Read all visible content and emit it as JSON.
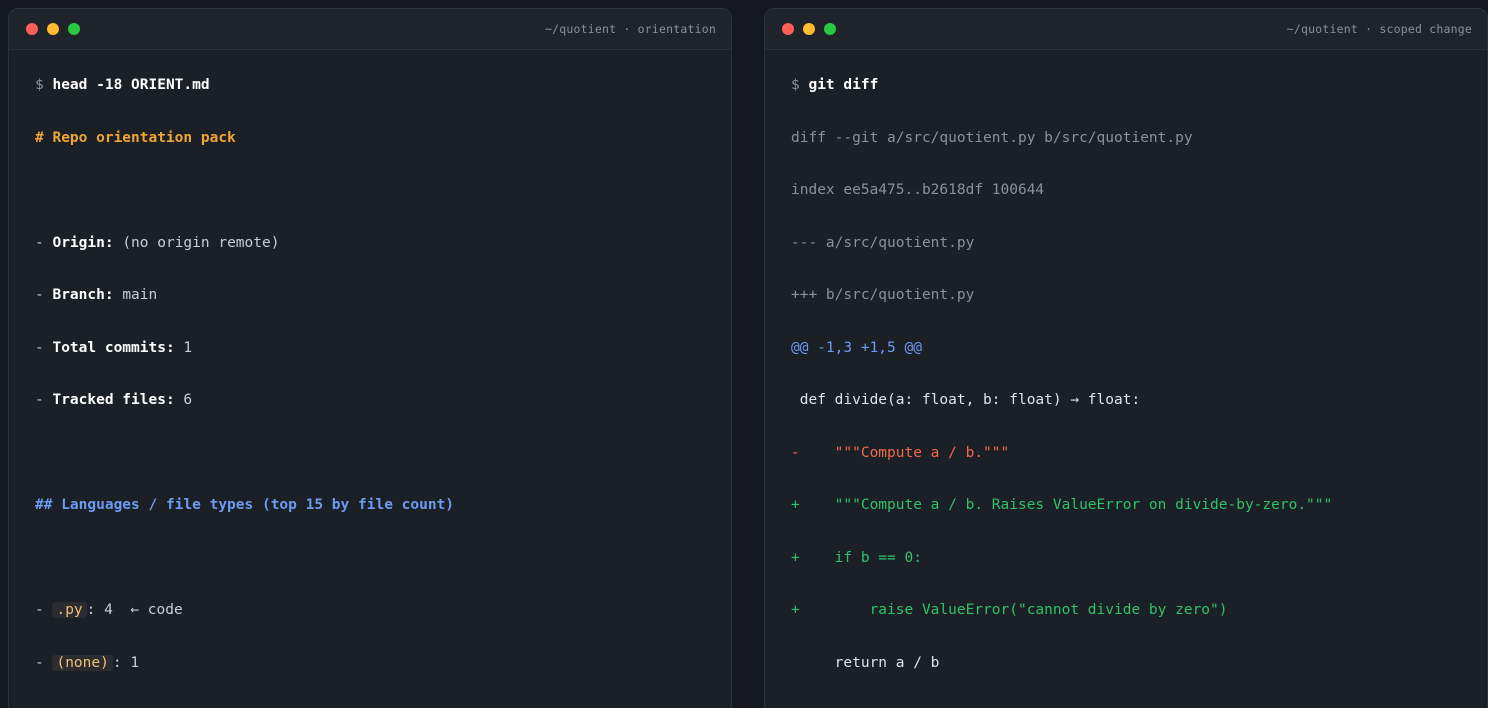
{
  "left_window": {
    "title": "~/quotient · orientation",
    "prompt_symbol": "$",
    "command": "head -18 ORIENT.md",
    "heading1": "# Repo orientation pack",
    "bullet": "-",
    "origin_key": "Origin:",
    "origin_val": "(no origin remote)",
    "branch_key": "Branch:",
    "branch_val": "main",
    "commits_key": "Total commits:",
    "commits_val": "1",
    "files_key": "Tracked files:",
    "files_val": "6",
    "heading2": "## Languages / file types (top 15 by file count)",
    "lang1_ext": ".py",
    "lang1_count": ": 4",
    "lang1_note": "← code",
    "lang2_ext": "(none)",
    "lang2_count": ": 1"
  },
  "right_window": {
    "title": "~/quotient · scoped change",
    "prompt_symbol": "$",
    "command": "git diff",
    "lines": [
      {
        "kind": "meta",
        "text": "diff --git a/src/quotient.py b/src/quotient.py"
      },
      {
        "kind": "meta",
        "text": "index ee5a475..b2618df 100644"
      },
      {
        "kind": "meta",
        "text": "--- a/src/quotient.py"
      },
      {
        "kind": "meta",
        "text": "+++ b/src/quotient.py"
      },
      {
        "kind": "hunk",
        "text": "@@ -1,3 +1,5 @@"
      },
      {
        "kind": "ctx",
        "text": " def divide(a: float, b: float) → float:"
      },
      {
        "kind": "del",
        "text": "-    \"\"\"Compute a / b.\"\"\""
      },
      {
        "kind": "add",
        "text": "+    \"\"\"Compute a / b. Raises ValueError on divide-by-zero.\"\"\""
      },
      {
        "kind": "add",
        "text": "+    if b == 0:"
      },
      {
        "kind": "add",
        "text": "+        raise ValueError(\"cannot divide by zero\")"
      },
      {
        "kind": "ctx",
        "text": "     return a / b"
      }
    ]
  },
  "colors": {
    "heading1": "#f0a534",
    "heading2": "#6d9bf2",
    "diff_add": "#2ec26a",
    "diff_del": "#f06a4b",
    "diff_hunk": "#6d9bf2"
  }
}
